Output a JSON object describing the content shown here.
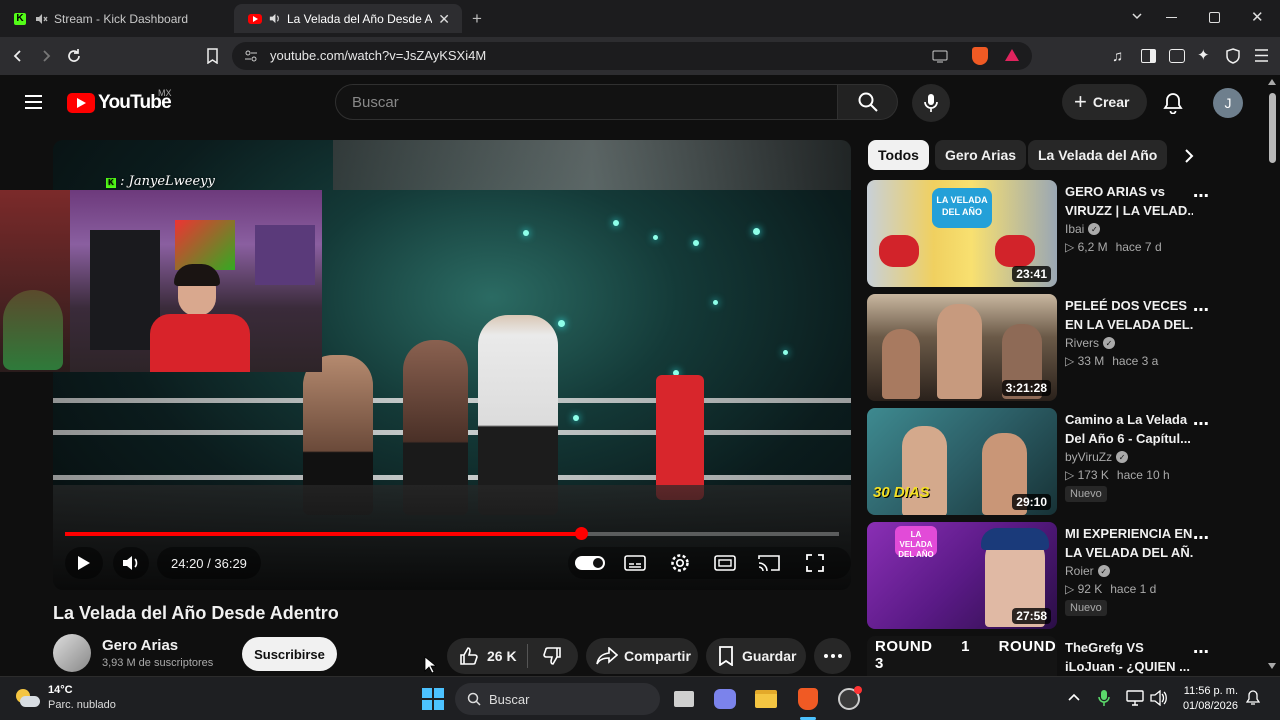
{
  "browser": {
    "tabs": [
      {
        "title": "Stream - Kick Dashboard",
        "active": false
      },
      {
        "title": "La Velada del Año Desde Aden",
        "active": true
      }
    ],
    "url": "youtube.com/watch?v=JsZAyKSXi4M"
  },
  "youtube": {
    "logo_text": "YouTube",
    "region": "MX",
    "search_placeholder": "Buscar",
    "create_label": "Crear",
    "avatar_letter": "J"
  },
  "player": {
    "time_display": "24:20 / 36:29",
    "progress_fraction": 0.667,
    "webcam_name": ": JanyeLweeyy"
  },
  "video": {
    "title": "La Velada del Año Desde Adentro",
    "channel": "Gero Arias",
    "subscribers": "3,93 M de suscriptores",
    "subscribe_label": "Suscribirse",
    "likes": "26 K",
    "share_label": "Compartir",
    "save_label": "Guardar"
  },
  "chips": [
    "Todos",
    "Gero Arias",
    "La Velada del Año"
  ],
  "recommendations": [
    {
      "title1": "GERO ARIAS vs",
      "title2": "VIRUZZ | LA VELAD...",
      "channel": "Ibai",
      "views": "6,2 M",
      "age": "hace 7 d",
      "duration": "23:41",
      "badge": "",
      "thumb_text": "LA VELADA DEL AÑO"
    },
    {
      "title1": "PELEÉ DOS VECES",
      "title2": "EN LA VELADA DEL...",
      "channel": "Rivers",
      "views": "33 M",
      "age": "hace 3 a",
      "duration": "3:21:28",
      "badge": "",
      "thumb_text": ""
    },
    {
      "title1": "Camino a La Velada",
      "title2": "Del Año 6 - Capítul...",
      "channel": "byViruZz",
      "views": "173 K",
      "age": "hace 10 h",
      "duration": "29:10",
      "badge": "Nuevo",
      "thumb_text": "30 DIAS"
    },
    {
      "title1": "MI EXPERIENCIA EN",
      "title2": "LA VELADA DEL AÑ...",
      "channel": "Roier",
      "views": "92 K",
      "age": "hace 1 d",
      "duration": "27:58",
      "badge": "Nuevo",
      "thumb_text": "LA VELADA DEL AÑO"
    },
    {
      "title1": "TheGrefg VS",
      "title2": "iLoJuan - ¿QUIEN ...",
      "channel": "",
      "views": "",
      "age": "",
      "duration": "",
      "badge": "",
      "thumb_text": "ROUND 1 ROUND 3"
    }
  ],
  "taskbar": {
    "weather_temp": "14°C",
    "weather_desc": "Parc. nublado",
    "search_label": "Buscar",
    "time": "11:56 p. m.",
    "date": "01/08/2026"
  }
}
